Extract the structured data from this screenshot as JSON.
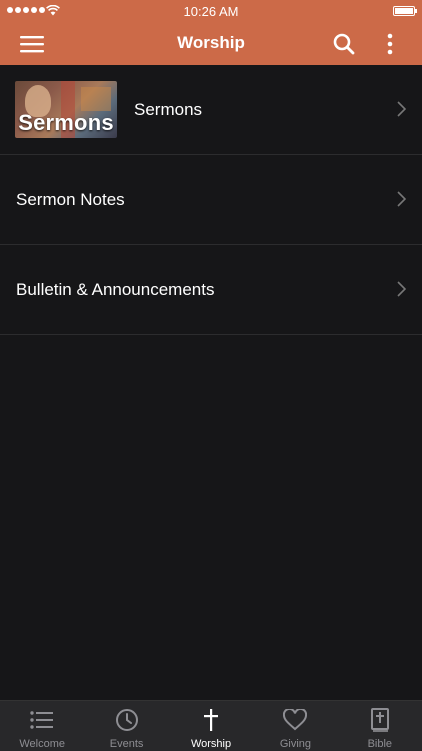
{
  "status_bar": {
    "time": "10:26 AM"
  },
  "header": {
    "title": "Worship"
  },
  "thumbnail": {
    "text": "Sermons"
  },
  "rows": [
    {
      "label": "Sermons"
    },
    {
      "label": "Sermon Notes"
    },
    {
      "label": "Bulletin & Announcements"
    }
  ],
  "tabs": [
    {
      "label": "Welcome",
      "icon": "list-icon"
    },
    {
      "label": "Events",
      "icon": "clock-icon"
    },
    {
      "label": "Worship",
      "icon": "cross-icon"
    },
    {
      "label": "Giving",
      "icon": "heart-icon"
    },
    {
      "label": "Bible",
      "icon": "bible-icon"
    }
  ],
  "colors": {
    "accent": "#cc6a48",
    "background": "#161618",
    "tabbar": "#28282a",
    "inactive": "#8e8e93"
  }
}
